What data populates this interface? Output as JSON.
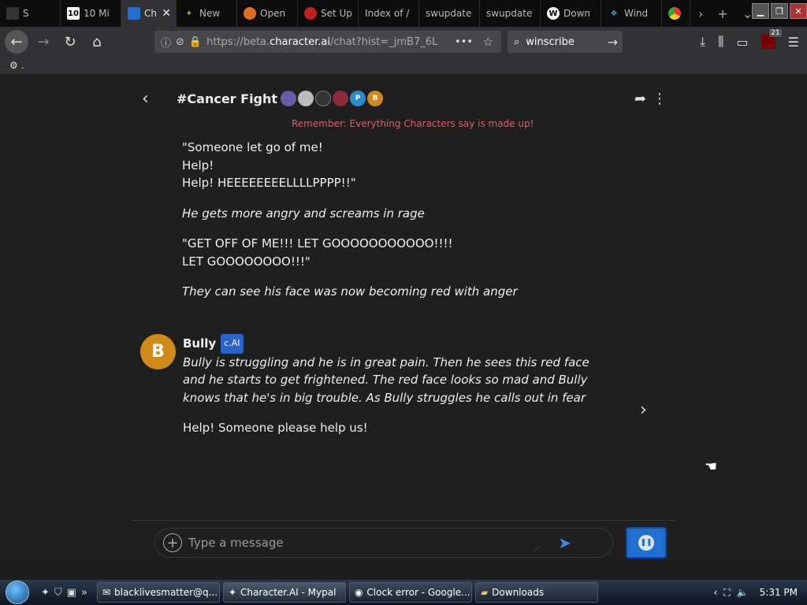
{
  "browser": {
    "tabs": [
      {
        "label": "S",
        "icon": "tab-icon"
      },
      {
        "label": "10 Mi",
        "icon": "ten-icon"
      },
      {
        "label": "Ch",
        "icon": "character-ai-icon",
        "active": true
      },
      {
        "label": "New",
        "icon": "mypal-icon"
      },
      {
        "label": "Open",
        "icon": "open-icon"
      },
      {
        "label": "Set Up",
        "icon": "setup-icon"
      },
      {
        "label": "Index of /",
        "icon": ""
      },
      {
        "label": "swupdate",
        "icon": ""
      },
      {
        "label": "swupdate",
        "icon": ""
      },
      {
        "label": "Down",
        "icon": "wordpress-icon"
      },
      {
        "label": "Wind",
        "icon": "windscribe-icon"
      },
      {
        "label": "",
        "icon": "chrome-icon"
      }
    ],
    "url_prefix": "https://beta.",
    "url_domain": "character.ai",
    "url_rest": "/chat?hist=_jmB7_6L",
    "search_value": "winscribe",
    "ublock_count": "21",
    "bookmark_label": "."
  },
  "chat": {
    "title": "#Cancer Fight",
    "participant_initials": [
      "P",
      "B"
    ],
    "disclaimer": "Remember: Everything Characters say is made up!",
    "user_lines": [
      {
        "text": "\"Someone let go of me!",
        "italic": false
      },
      {
        "text": "Help!",
        "italic": false
      },
      {
        "text": "Help! HEEEEEEEELLLLPPPP!!\"",
        "italic": false
      },
      {
        "text": "He gets more angry and screams in rage",
        "italic": true
      },
      {
        "text": "\"GET OFF OF ME!!! LET GOOOOOOOOOOO!!!!",
        "italic": false
      },
      {
        "text": "LET GOOOOOOOO!!!\"",
        "italic": false
      },
      {
        "text": "They can see his face was now becoming red with anger",
        "italic": true
      }
    ],
    "bot": {
      "avatar_letter": "B",
      "name": "Bully",
      "badge": "c.AI",
      "paragraph1": "Bully is struggling and he is in great pain.  Then he sees this red face and he starts to get frightened.  The red face looks so mad and Bully knows that he's in big trouble.  As Bully struggles he calls out in fear",
      "paragraph2": "Help!  Someone please help us!"
    },
    "input_placeholder": "Type a message"
  },
  "taskbar": {
    "buttons": [
      {
        "label": "blacklivesmatter@q...",
        "icon": "email-icon"
      },
      {
        "label": "Character.AI - Mypal",
        "icon": "mypal-icon",
        "active": true
      },
      {
        "label": "Clock error - Google...",
        "icon": "chrome-icon"
      },
      {
        "label": "Downloads",
        "icon": "folder-icon"
      }
    ],
    "clock": "5:31 PM"
  },
  "colors": {
    "accent_blue": "#1e6fd0",
    "disclaimer_red": "#e05a6a",
    "bot_avatar": "#d08a1a"
  }
}
